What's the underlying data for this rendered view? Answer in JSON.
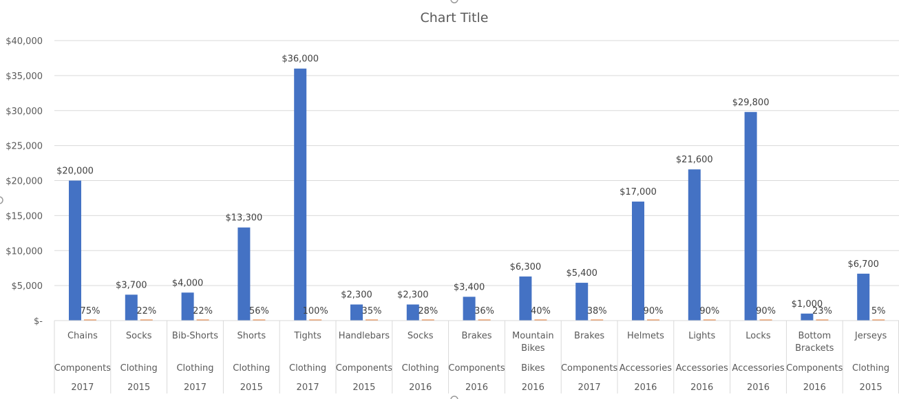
{
  "chart_data": {
    "type": "bar",
    "title": "Chart Title",
    "categories": [
      {
        "product": "Chains",
        "category": "Components",
        "year": "2017"
      },
      {
        "product": "Socks",
        "category": "Clothing",
        "year": "2015"
      },
      {
        "product": "Bib-Shorts",
        "category": "Clothing",
        "year": "2017"
      },
      {
        "product": "Shorts",
        "category": "Clothing",
        "year": "2015"
      },
      {
        "product": "Tights",
        "category": "Clothing",
        "year": "2017"
      },
      {
        "product": "Handlebars",
        "category": "Components",
        "year": "2015"
      },
      {
        "product": "Socks",
        "category": "Clothing",
        "year": "2016"
      },
      {
        "product": "Brakes",
        "category": "Components",
        "year": "2016"
      },
      {
        "product": "Mountain Bikes",
        "category": "Bikes",
        "year": "2016"
      },
      {
        "product": "Brakes",
        "category": "Components",
        "year": "2017"
      },
      {
        "product": "Helmets",
        "category": "Accessories",
        "year": "2016"
      },
      {
        "product": "Lights",
        "category": "Accessories",
        "year": "2016"
      },
      {
        "product": "Locks",
        "category": "Accessories",
        "year": "2016"
      },
      {
        "product": "Bottom Brackets",
        "category": "Components",
        "year": "2016"
      },
      {
        "product": "Jerseys",
        "category": "Clothing",
        "year": "2015"
      }
    ],
    "series": [
      {
        "values": [
          20000,
          3700,
          4000,
          13300,
          36000,
          2300,
          2300,
          3400,
          6300,
          5400,
          17000,
          21600,
          29800,
          1000,
          6700
        ],
        "labels": [
          "$20,000",
          "$3,700",
          "$4,000",
          "$13,300",
          "$36,000",
          "$2,300",
          "$2,300",
          "$3,400",
          "$6,300",
          "$5,400",
          "$17,000",
          "$21,600",
          "$29,800",
          "$1,000",
          "$6,700"
        ],
        "color": "#4472C4"
      },
      {
        "values": [
          0.75,
          0.22,
          0.22,
          0.56,
          1.0,
          0.35,
          0.28,
          0.36,
          0.4,
          0.38,
          0.9,
          0.9,
          0.9,
          0.23,
          0.05
        ],
        "labels": [
          "75%",
          "22%",
          "22%",
          "56%",
          "100%",
          "35%",
          "28%",
          "36%",
          "40%",
          "38%",
          "90%",
          "90%",
          "90%",
          "23%",
          "5%"
        ],
        "color": "#ED7D31"
      }
    ],
    "ylim": [
      0,
      40000
    ],
    "yticks": [
      0,
      5000,
      10000,
      15000,
      20000,
      25000,
      30000,
      35000,
      40000
    ],
    "ytick_labels": [
      "$-",
      "$5,000",
      "$10,000",
      "$15,000",
      "$20,000",
      "$25,000",
      "$30,000",
      "$35,000",
      "$40,000"
    ],
    "grid": true,
    "legend": "none"
  }
}
